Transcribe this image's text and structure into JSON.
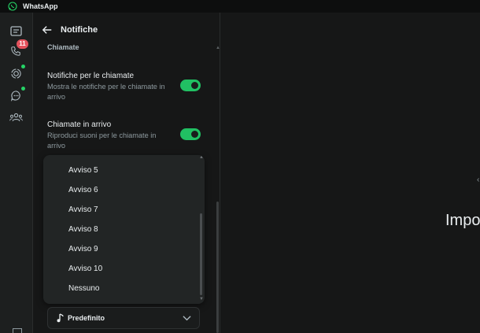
{
  "app": {
    "title": "WhatsApp"
  },
  "rail": {
    "items": [
      {
        "icon": "chats-icon"
      },
      {
        "icon": "calls-icon",
        "badge": "11"
      },
      {
        "icon": "status-icon",
        "dot": true
      },
      {
        "icon": "channels-icon",
        "dot": true
      },
      {
        "icon": "communities-icon"
      }
    ]
  },
  "panel": {
    "title": "Notifiche",
    "section": "Chiamate",
    "settings": [
      {
        "title": "Notifiche per le chiamate",
        "desc": "Mostra le notifiche per le chiamate in arrivo",
        "enabled": true
      },
      {
        "title": "Chiamate in arrivo",
        "desc": "Riproduci suoni per le chiamate in arrivo",
        "enabled": true
      }
    ],
    "dropdown": {
      "options": [
        "Avviso 5",
        "Avviso 6",
        "Avviso 7",
        "Avviso 8",
        "Avviso 9",
        "Avviso 10",
        "Nessuno"
      ]
    },
    "select": {
      "value": "Predefinito"
    }
  },
  "main": {
    "text": "Impo",
    "edge_char": "‹"
  },
  "colors": {
    "accent": "#21c063",
    "badge": "#e2515c",
    "background": "#161717"
  }
}
